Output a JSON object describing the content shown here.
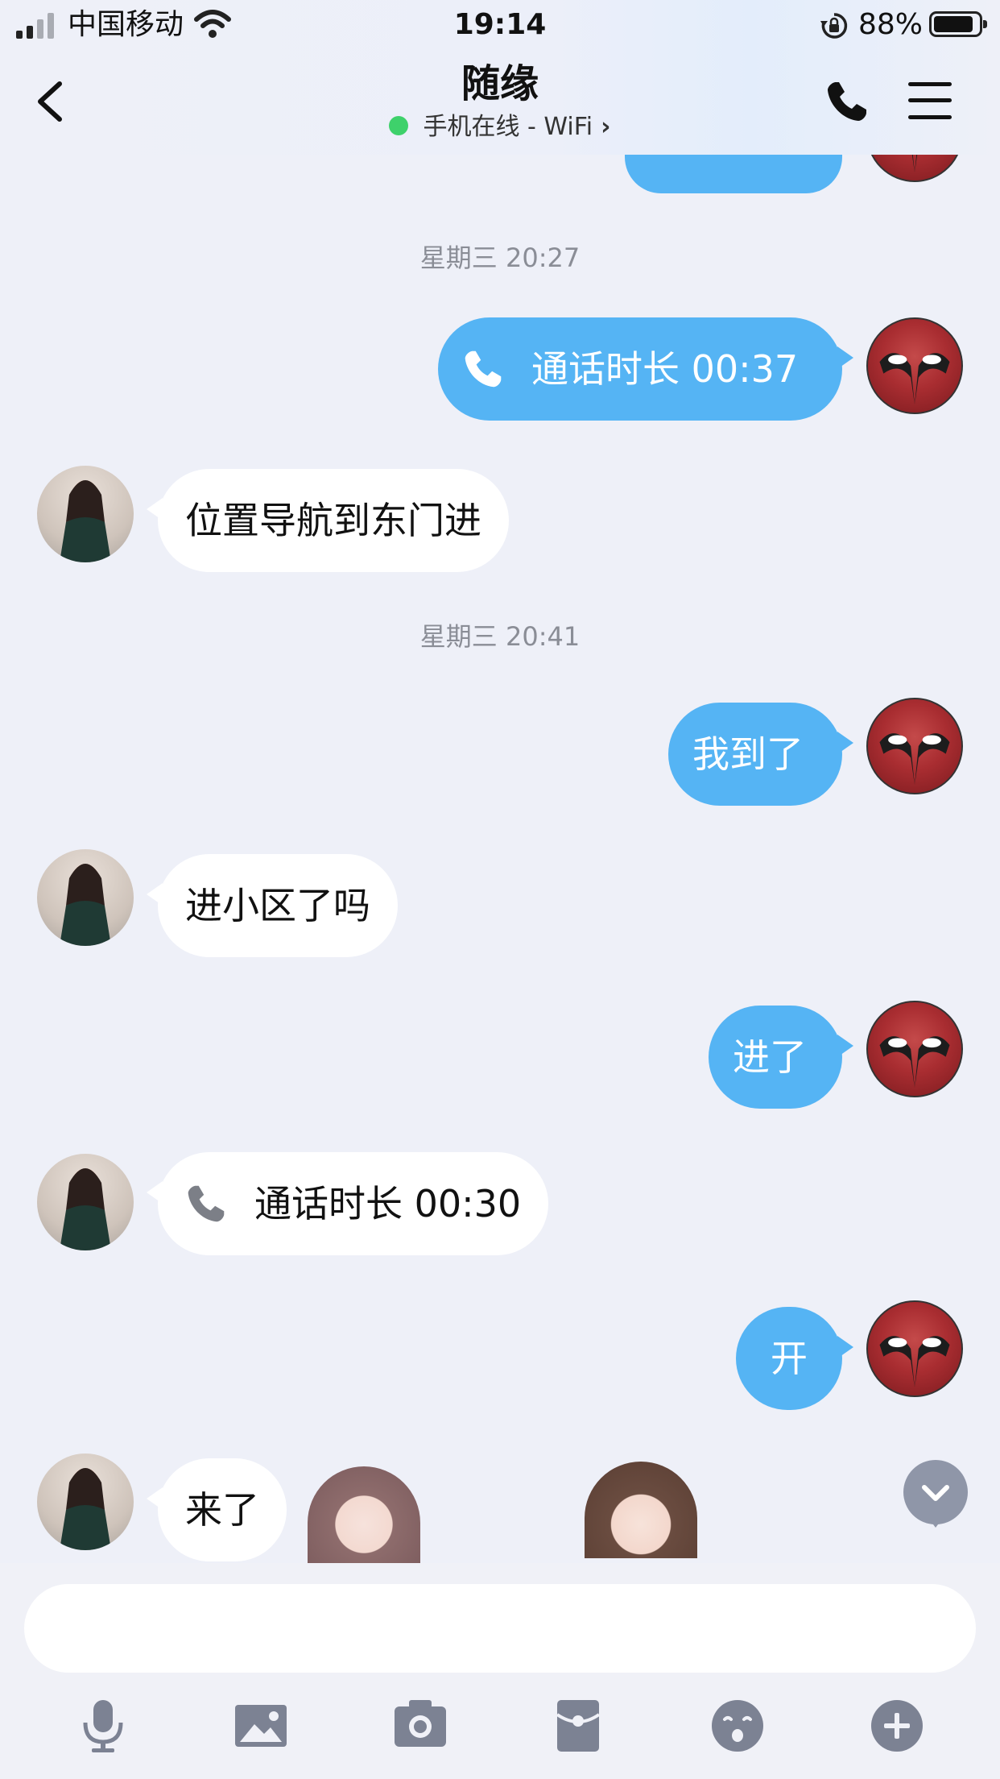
{
  "status_bar": {
    "carrier": "中国移动",
    "time": "19:14",
    "battery_percent": "88%",
    "battery_level": 0.88,
    "signal_bars": 2
  },
  "header": {
    "title": "随缘",
    "subtitle": "手机在线 - WiFi",
    "online_color": "#3ed16b"
  },
  "messages": [
    {
      "kind": "timestamp",
      "text": "星期三 20:27"
    },
    {
      "kind": "call",
      "side": "out",
      "text": "通话时长 00:37"
    },
    {
      "kind": "text",
      "side": "in",
      "text": "位置导航到东门进"
    },
    {
      "kind": "timestamp",
      "text": "星期三 20:41"
    },
    {
      "kind": "text",
      "side": "out",
      "text": "我到了"
    },
    {
      "kind": "text",
      "side": "in",
      "text": "进小区了吗"
    },
    {
      "kind": "text",
      "side": "out",
      "text": "进了"
    },
    {
      "kind": "call",
      "side": "in",
      "text": "通话时长 00:30"
    },
    {
      "kind": "text",
      "side": "out",
      "text": "开"
    },
    {
      "kind": "text",
      "side": "in",
      "text": "来了"
    }
  ],
  "colors": {
    "outgoing_bubble": "#55b4f4",
    "incoming_bubble": "#ffffff",
    "background": "#eef0f8"
  },
  "input": {
    "value": "",
    "placeholder": ""
  },
  "toolbar": {
    "icons": [
      "microphone-icon",
      "image-icon",
      "camera-icon",
      "red-packet-icon",
      "emoji-icon",
      "plus-icon"
    ]
  }
}
